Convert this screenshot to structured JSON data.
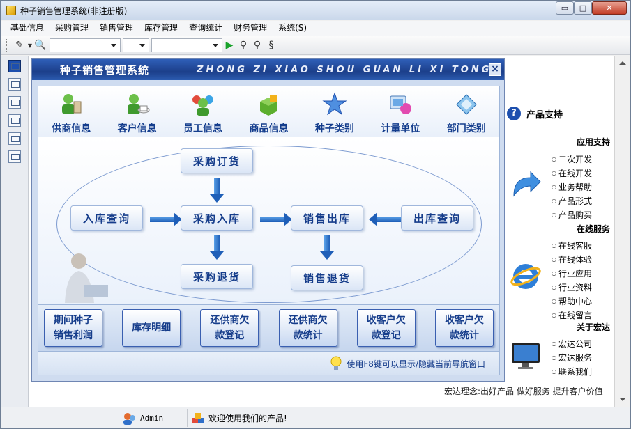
{
  "window": {
    "title": "种子销售管理系统(非注册版)",
    "controls": {
      "minimize": "▭",
      "maximize": "□",
      "close": "✕"
    }
  },
  "menu": [
    "基础信息",
    "采购管理",
    "销售管理",
    "库存管理",
    "查询统计",
    "财务管理",
    "系统(S)"
  ],
  "nav": {
    "title": "种子销售管理系统",
    "subtitle": "ZHONG ZI XIAO SHOU GUAN LI XI TONG",
    "close_label": "×",
    "icons": [
      {
        "label": "供商信息",
        "icon": "supplier-icon"
      },
      {
        "label": "客户信息",
        "icon": "customer-icon"
      },
      {
        "label": "员工信息",
        "icon": "employee-icon"
      },
      {
        "label": "商品信息",
        "icon": "product-icon"
      },
      {
        "label": "种子类别",
        "icon": "star-icon"
      },
      {
        "label": "计量单位",
        "icon": "unit-icon"
      },
      {
        "label": "部门类别",
        "icon": "department-icon"
      }
    ],
    "flow": {
      "purchase_order": "采购订货",
      "stock_in_query": "入库查询",
      "purchase_in": "采购入库",
      "sales_out": "销售出库",
      "stock_out_query": "出库查询",
      "purchase_return": "采购退货",
      "sales_return": "销售退货"
    },
    "bottom_buttons": [
      "期间种子\n销售利润",
      "库存明细",
      "还供商欠\n款登记",
      "还供商欠\n款统计",
      "收客户欠\n款登记",
      "收客户欠\n款统计"
    ],
    "hint": "使用F8键可以显示/隐藏当前导航窗口"
  },
  "support": {
    "title": "产品支持",
    "sections": [
      {
        "heading": "应用支持",
        "items": [
          "二次开发",
          "在线开发",
          "业务帮助",
          "产品形式",
          "产品购买"
        ]
      },
      {
        "heading": "在线服务",
        "items": [
          "在线客服",
          "在线体验",
          "行业应用",
          "行业资料",
          "帮助中心",
          "在线留言"
        ]
      },
      {
        "heading": "关于宏达",
        "items": [
          "宏达公司",
          "宏达服务",
          "联系我们"
        ]
      }
    ]
  },
  "motto": "宏达理念:出好产品 做好服务 提升客户价值",
  "status": {
    "user": "Admin",
    "message": "欢迎使用我们的产品!"
  },
  "colors": {
    "accent": "#1d4fae",
    "nav_header": "#1c3f8a",
    "button_text": "#163d8b"
  }
}
